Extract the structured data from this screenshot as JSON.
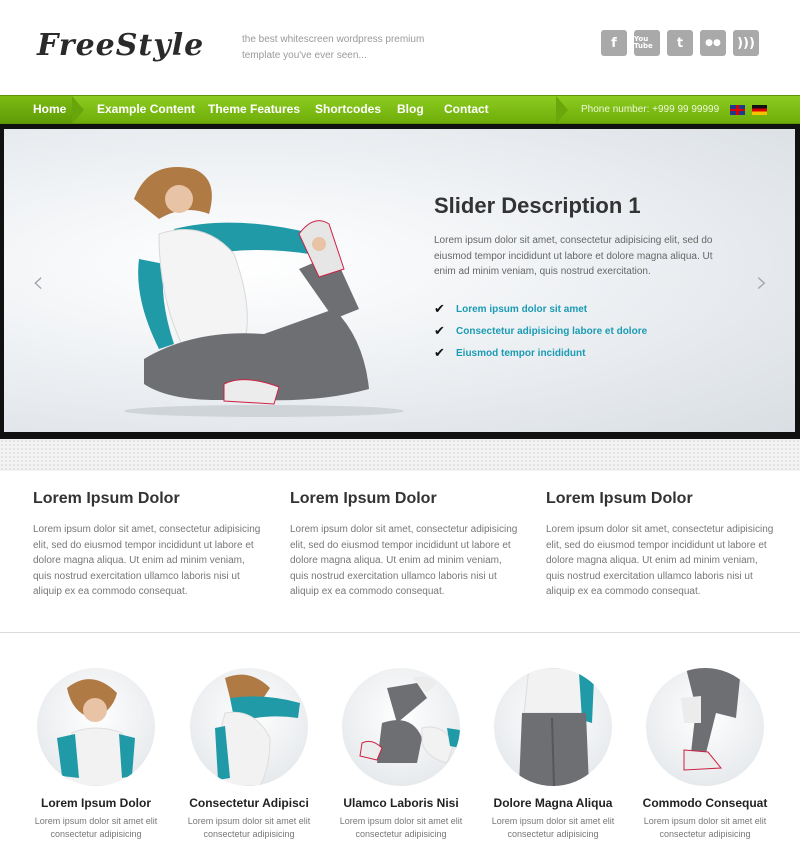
{
  "header": {
    "logo": "FreeStyle",
    "tagline": "the best whitescreen wordpress premium template you've ever seen...",
    "social": [
      {
        "icon": "facebook-icon",
        "glyph": "f"
      },
      {
        "icon": "youtube-icon",
        "glyph": "You Tube"
      },
      {
        "icon": "twitter-icon",
        "glyph": "t"
      },
      {
        "icon": "flickr-icon",
        "glyph": "●●"
      },
      {
        "icon": "rss-icon",
        "glyph": ")))"
      }
    ]
  },
  "nav": {
    "items": [
      "Home",
      "Example Content",
      "Theme Features",
      "Shortcodes",
      "Blog",
      "Contact"
    ],
    "phone": "Phone number: +999 99 99999",
    "flags": [
      "english-flag-icon",
      "german-flag-icon"
    ],
    "accent": "#7dbd12"
  },
  "slider": {
    "title": "Slider Description 1",
    "text": "Lorem ipsum dolor sit amet, consectetur adipisicing elit, sed do eiusmod tempor incididunt ut labore et dolore magna aliqua. Ut enim ad minim veniam, quis nostrud exercitation.",
    "checks": [
      "Lorem ipsum dolor sit amet",
      "Consectetur adipisicing labore et dolore",
      "Eiusmod tempor incididunt"
    ],
    "prev": "‹",
    "next": "›",
    "check_color": "#1a9bb4"
  },
  "columns": [
    {
      "title": "Lorem Ipsum Dolor",
      "text": "Lorem ipsum dolor sit amet, consectetur adipisicing elit, sed do eiusmod tempor incididunt ut labore et dolore magna aliqua. Ut enim ad minim veniam, quis nostrud exercitation ullamco laboris nisi ut aliquip ex ea commodo consequat."
    },
    {
      "title": "Lorem Ipsum Dolor",
      "text": "Lorem ipsum dolor sit amet, consectetur adipisicing elit, sed do eiusmod tempor incididunt ut labore et dolore magna aliqua. Ut enim ad minim veniam, quis nostrud exercitation ullamco laboris nisi ut aliquip ex ea commodo consequat."
    },
    {
      "title": "Lorem Ipsum Dolor",
      "text": "Lorem ipsum dolor sit amet, consectetur adipisicing elit, sed do eiusmod tempor incididunt ut labore et dolore magna aliqua. Ut enim ad minim veniam, quis nostrud exercitation ullamco laboris nisi ut aliquip ex ea commodo consequat."
    }
  ],
  "cards": [
    {
      "title": "Lorem Ipsum Dolor",
      "line1": "Lorem ipsum dolor sit amet elit",
      "line2": "consectetur adipisicing"
    },
    {
      "title": "Consectetur Adipisci",
      "line1": "Lorem ipsum dolor sit amet elit",
      "line2": "consectetur adipisicing"
    },
    {
      "title": "Ulamco Laboris Nisi",
      "line1": "Lorem ipsum dolor sit amet elit",
      "line2": "consectetur adipisicing"
    },
    {
      "title": "Dolore Magna Aliqua",
      "line1": "Lorem ipsum dolor sit amet elit",
      "line2": "consectetur adipisicing"
    },
    {
      "title": "Commodo Consequat",
      "line1": "Lorem ipsum dolor sit amet elit",
      "line2": "consectetur adipisicing"
    }
  ]
}
